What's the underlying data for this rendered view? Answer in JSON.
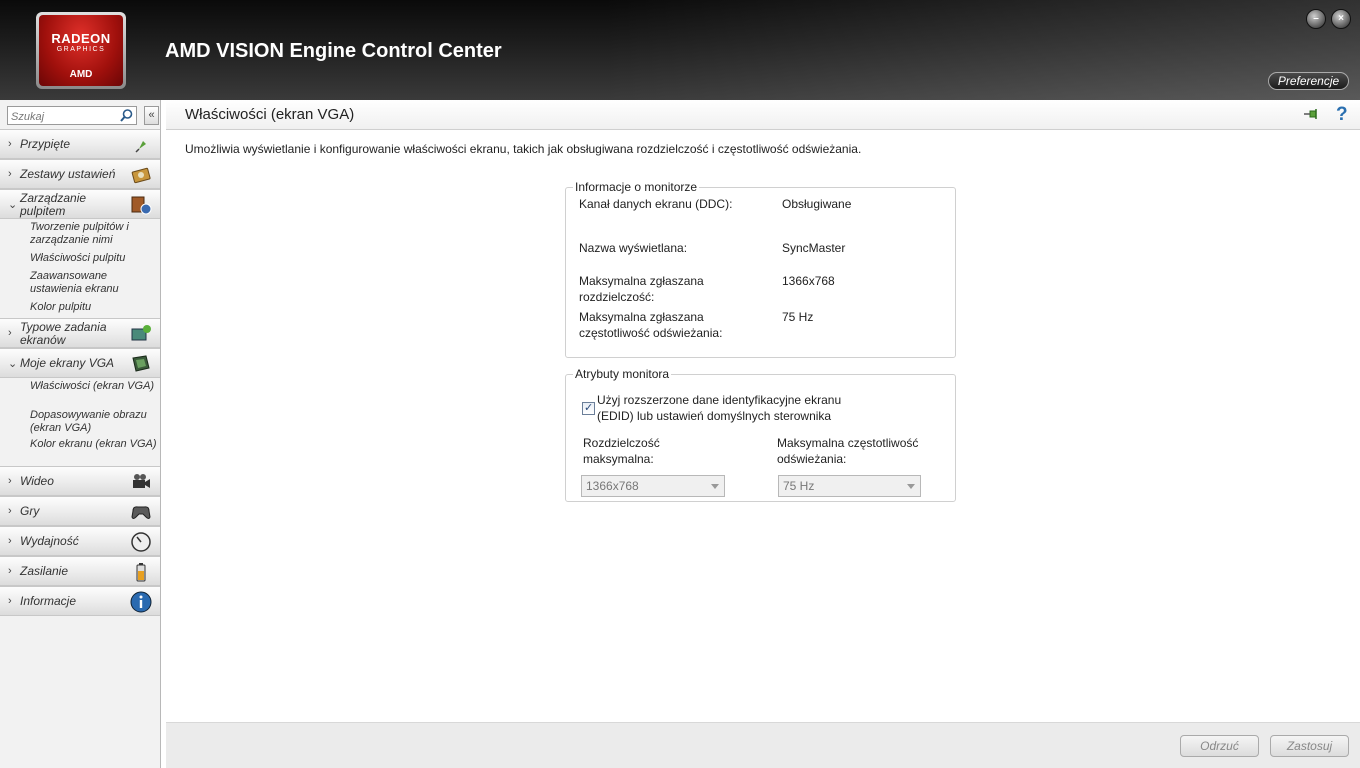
{
  "header": {
    "logo": {
      "line1": "RADEON",
      "line2": "GRAPHICS",
      "line3": "AMD"
    },
    "title": "AMD VISION Engine Control Center",
    "preferences_label": "Preferencje",
    "minimize_label": "–",
    "close_label": "×"
  },
  "sidebar": {
    "search_placeholder": "Szukaj",
    "collapse_label": "«",
    "items": [
      {
        "label": "Przypięte",
        "expanded": false,
        "icon": "pin-icon"
      },
      {
        "label": "Zestawy ustawień",
        "expanded": false,
        "icon": "presets-icon"
      },
      {
        "label": "Zarządzanie pulpitem",
        "expanded": true,
        "icon": "desktop-management-icon",
        "children": [
          "Tworzenie pulpitów i zarządzanie nimi",
          "Właściwości pulpitu",
          "Zaawansowane ustawienia ekranu",
          "Kolor pulpitu"
        ]
      },
      {
        "label": "Typowe zadania ekranów",
        "expanded": false,
        "icon": "display-tasks-icon"
      },
      {
        "label": "Moje ekrany VGA",
        "expanded": true,
        "icon": "vga-display-icon",
        "children": [
          "Właściwości (ekran VGA)",
          "Dopasowywanie obrazu (ekran VGA)",
          "Kolor ekranu (ekran VGA)"
        ]
      },
      {
        "label": "Wideo",
        "expanded": false,
        "icon": "video-camera-icon"
      },
      {
        "label": "Gry",
        "expanded": false,
        "icon": "gamepad-icon"
      },
      {
        "label": "Wydajność",
        "expanded": false,
        "icon": "gauge-icon"
      },
      {
        "label": "Zasilanie",
        "expanded": false,
        "icon": "battery-icon"
      },
      {
        "label": "Informacje",
        "expanded": false,
        "icon": "info-icon"
      }
    ]
  },
  "main": {
    "title": "Właściwości (ekran VGA)",
    "help_label": "?",
    "description": "Umożliwia wyświetlanie i konfigurowanie właściwości ekranu, takich jak obsługiwana rozdzielczość i częstotliwość odświeżania.",
    "monitor_info": {
      "legend": "Informacje o monitorze",
      "rows": [
        {
          "label": "Kanał danych ekranu (DDC):",
          "value": "Obsługiwane"
        },
        {
          "label": "Nazwa wyświetlana:",
          "value": "SyncMaster"
        },
        {
          "label": "Maksymalna zgłaszana rozdzielczość:",
          "value": "1366x768"
        },
        {
          "label": "Maksymalna zgłaszana częstotliwość odświeżania:",
          "value": "75 Hz"
        }
      ]
    },
    "monitor_attributes": {
      "legend": "Atrybuty monitora",
      "edid_checkbox_label": "Użyj rozszerzone dane identyfikacyjne ekranu (EDID) lub ustawień domyślnych sterownika",
      "edid_checked": true,
      "max_resolution_label": "Rozdzielczość maksymalna:",
      "max_resolution_value": "1366x768",
      "max_refresh_label": "Maksymalna częstotliwość odświeżania:",
      "max_refresh_value": "75 Hz"
    }
  },
  "footer": {
    "discard_label": "Odrzuć",
    "apply_label": "Zastosuj"
  }
}
